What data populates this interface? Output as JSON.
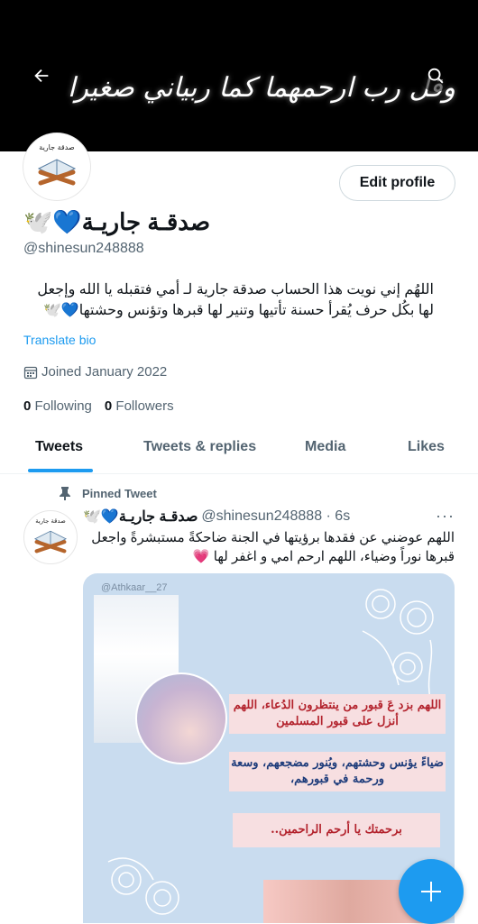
{
  "header": {
    "banner_text": "وقل رب ارحمهما كما ربياني صغيرا",
    "back_icon": "arrow-left-icon",
    "search_icon": "search-icon"
  },
  "profile": {
    "avatar_caption": "صدقة جارية",
    "edit_label": "Edit profile",
    "name": "صدقـة جاريـة💙🕊️",
    "handle": "@shinesun248888",
    "bio": "اللهُم إني نويت هذا الحساب صدقة جارية لـ أمي فتقبله يا الله وإجعل لها بكُل حرف يُقرأ حسنة تأتيها وتنير لها قبرها وتؤنس وحشتها💙🕊️",
    "translate_label": "Translate bio",
    "joined": "Joined January 2022",
    "following_count": "0",
    "following_label": "Following",
    "followers_count": "0",
    "followers_label": "Followers"
  },
  "tabs": [
    {
      "label": "Tweets"
    },
    {
      "label": "Tweets & replies"
    },
    {
      "label": "Media"
    },
    {
      "label": "Likes"
    }
  ],
  "tweet": {
    "pinned_label": "Pinned Tweet",
    "name": "صدقـة جاريـة💙🕊️",
    "handle_time": "@shinesun248888 · 6s",
    "text": "اللهم عوضني عن فقدها برؤيتها في الجنة ضاحكةً مستبشرةً واجعل قبرها نوراً وضياء، اللهم ارحم امي و اغفر لها 💗",
    "media": {
      "credit": "@Athkaar__27",
      "line1": "اللهم بزد عَ قبور من ينتظرون الدُعاء، اللهم أنزل على قبور المسلمين",
      "line2": "ضياءً يؤنس وحشتهم، ويُنور مضجعهم، وسعة ورحمة في قبورهم،",
      "line3": "برحمتك يا أرحم الراحمين.."
    }
  },
  "fab_icon": "plus-icon"
}
